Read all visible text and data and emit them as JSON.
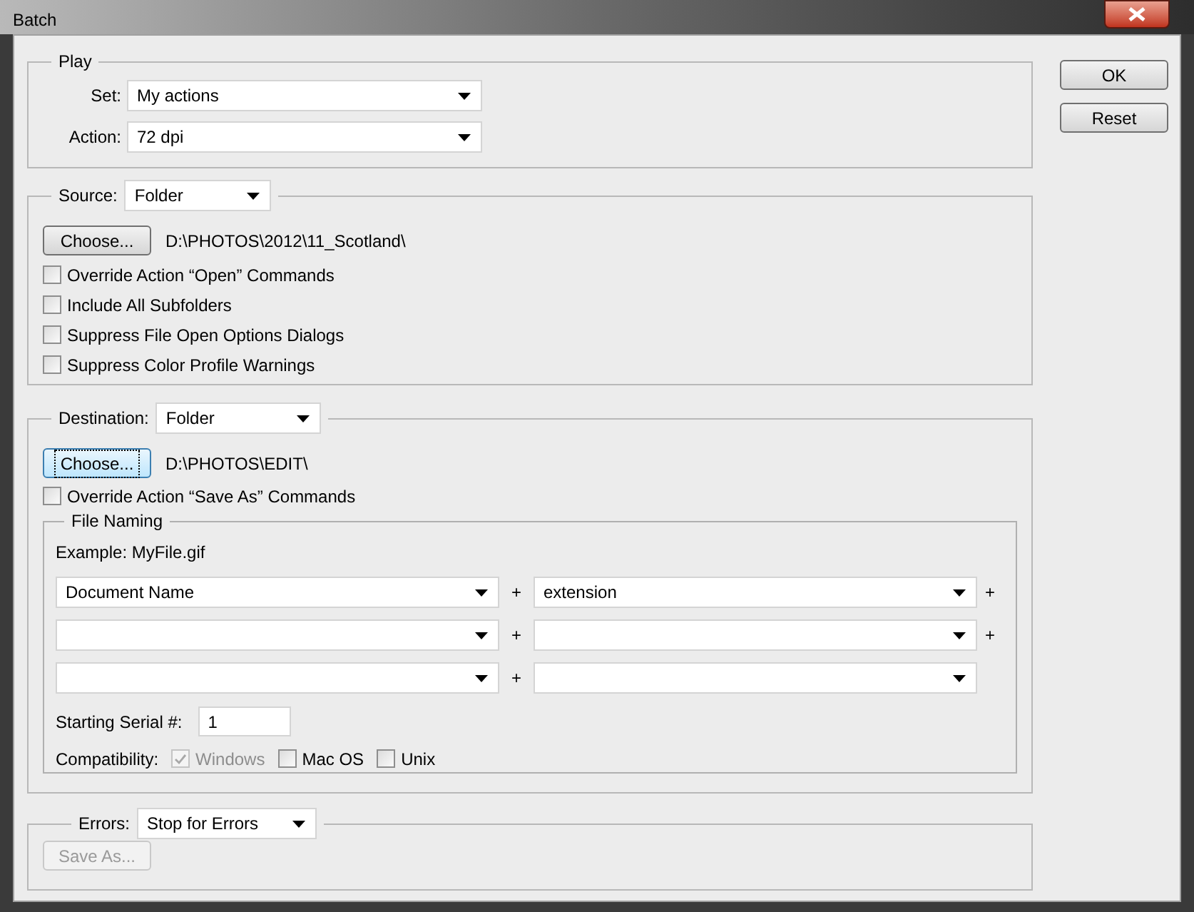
{
  "window": {
    "title": "Batch"
  },
  "play": {
    "title": "Play",
    "set": {
      "label": "Set:",
      "value": "My actions"
    },
    "action": {
      "label": "Action:",
      "value": "72 dpi"
    }
  },
  "source": {
    "label": "Source:",
    "value": "Folder",
    "choose": {
      "label": "Choose...",
      "focused": false
    },
    "path": "D:\\PHOTOS\\2012\\11_Scotland\\",
    "options": [
      {
        "label": "Override Action “Open” Commands",
        "checked": false
      },
      {
        "label": "Include All Subfolders",
        "checked": false
      },
      {
        "label": "Suppress File Open Options Dialogs",
        "checked": false
      },
      {
        "label": "Suppress Color Profile Warnings",
        "checked": false
      }
    ]
  },
  "destination": {
    "label": "Destination:",
    "value": "Folder",
    "choose": {
      "label": "Choose...",
      "focused": true
    },
    "path": "D:\\PHOTOS\\EDIT\\",
    "options": [
      {
        "label": "Override Action “Save As” Commands",
        "checked": false
      }
    ],
    "file_naming": {
      "title": "File Naming",
      "example": "Example: MyFile.gif",
      "rows": [
        {
          "fields": [
            "Document Name",
            "extension"
          ],
          "joiner": "+",
          "trailing": "+"
        },
        {
          "joiner": "+",
          "trailing": "+"
        },
        {
          "joiner": "+"
        }
      ],
      "serial": {
        "label": "Starting Serial #:",
        "value": "1"
      },
      "compatibility": {
        "label": "Compatibility:",
        "options": [
          {
            "label": "Windows",
            "checked": true,
            "disabled": true
          },
          {
            "label": "Mac OS",
            "checked": false,
            "disabled": false
          },
          {
            "label": "Unix",
            "checked": false,
            "disabled": false
          }
        ]
      }
    }
  },
  "errors": {
    "label": "Errors:",
    "value": "Stop for Errors",
    "save_as": {
      "label": "Save As...",
      "disabled": true
    }
  },
  "buttons": [
    {
      "label": "OK"
    },
    {
      "label": "Reset"
    }
  ]
}
